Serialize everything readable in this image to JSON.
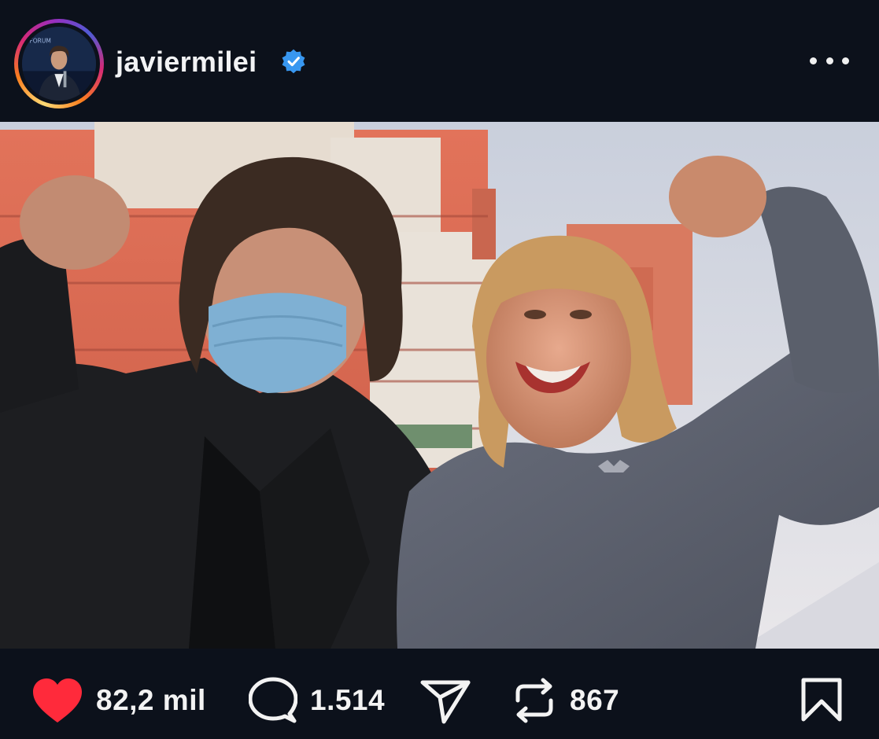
{
  "post": {
    "username": "javiermilei",
    "verified": true,
    "accent_color": "#3897f0",
    "like_color": "#ff2a3b",
    "icons": {
      "avatar": "profile-photo",
      "verified": "verified-badge-icon",
      "more": "more-options-icon",
      "like": "heart-icon",
      "comment": "comment-icon",
      "share": "send-icon",
      "repost": "repost-icon",
      "save": "bookmark-icon"
    },
    "stats": {
      "likes": "82,2 mil",
      "comments": "1.514",
      "reposts": "867"
    }
  }
}
